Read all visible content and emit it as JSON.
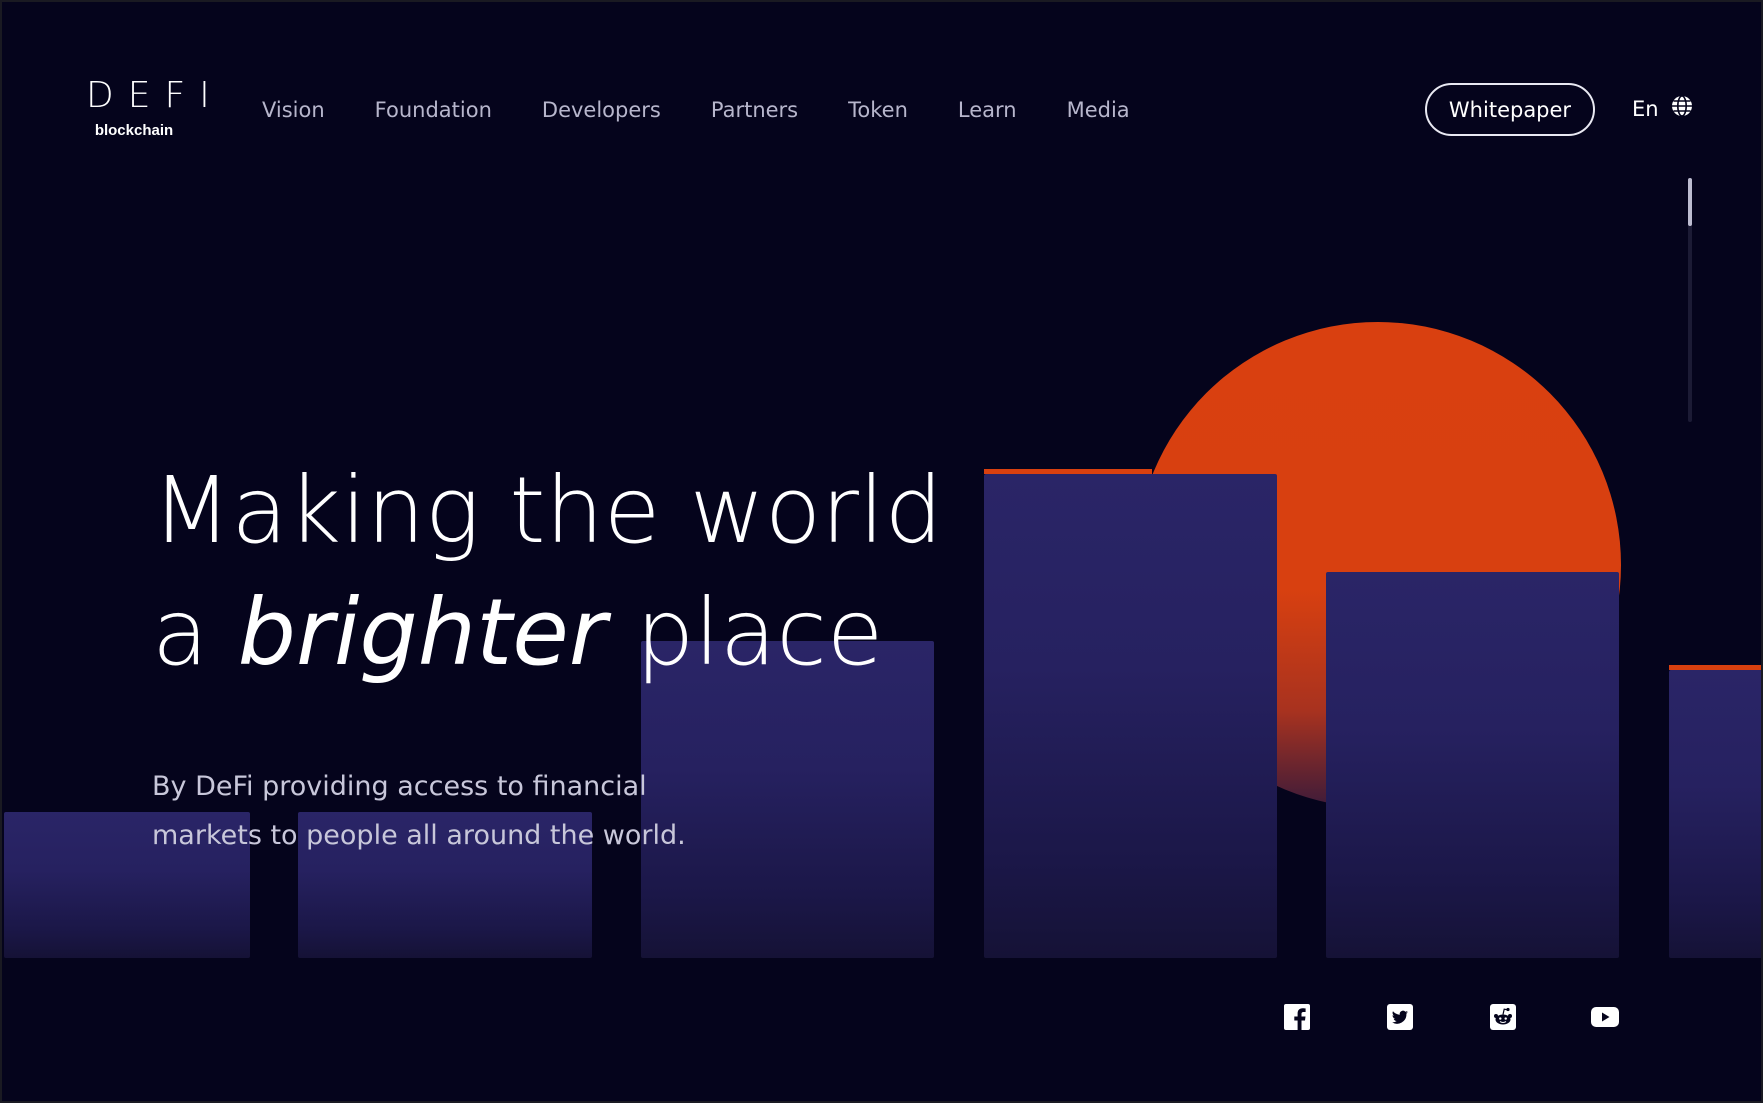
{
  "brand": {
    "logo_text": "DEFI",
    "logo_subtitle": "blockchain"
  },
  "nav": {
    "items": [
      "Vision",
      "Foundation",
      "Developers",
      "Partners",
      "Token",
      "Learn",
      "Media"
    ]
  },
  "header": {
    "whitepaper_label": "Whitepaper",
    "language_label": "En",
    "language_icon": "globe-icon"
  },
  "hero": {
    "title_line1": "Making the world",
    "title_line2_prefix": "a ",
    "title_line2_emphasis": "brighter",
    "title_line2_suffix": " place",
    "subtitle_line1": "By DeFi providing access to financial",
    "subtitle_line2": "markets to people all around the world."
  },
  "social": {
    "icons": [
      "facebook-icon",
      "twitter-icon",
      "reddit-icon",
      "youtube-icon"
    ]
  },
  "colors": {
    "background": "#05041c",
    "accent": "#d9400f",
    "bar": "#2a2567",
    "nav_text": "#b7b6cc"
  }
}
